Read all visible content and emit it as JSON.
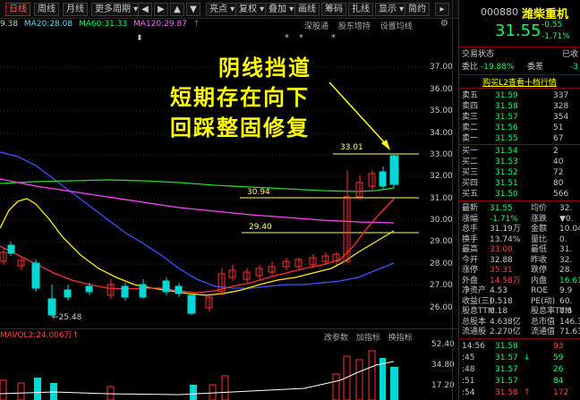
{
  "toolbar": {
    "left_partial": "9.38",
    "items": [
      "日线",
      "周线",
      "月线",
      "更多周期",
      "亮点",
      "复权",
      "叠加",
      "画线",
      "筹码",
      "扎线",
      "显示",
      "简约"
    ]
  },
  "ma_row": {
    "ma20": "MA20:28.08",
    "ma60": "MA60:31.33",
    "ma120": "MA120:29.87",
    "subtabs": [
      "深股通",
      "股东增持",
      "设置均线"
    ]
  },
  "price_axis": [
    "37.00",
    "36.00",
    "35.00",
    "34.00",
    "33.00",
    "32.00",
    "31.00",
    "30.00",
    "29.00",
    "28.00",
    "27.00",
    "26.00"
  ],
  "level_labels": {
    "high": "33.01",
    "mid": "30.94",
    "low": "29.40",
    "min": "25.48"
  },
  "annotation": [
    "阴线挡道",
    "短期存在向下",
    "回踩整固修复"
  ],
  "volume": {
    "header": "MAVOL2:24.006万",
    "tabs": [
      "改参数",
      "加指标",
      "换指标"
    ],
    "axis": [
      "52.40",
      "34.80",
      "17.20"
    ]
  },
  "quote": {
    "code": "000880",
    "name": "潍柴重机",
    "price": "31.55",
    "change": "-0.55",
    "change_pct": "-1.71%",
    "trade_status_label": "交易状态",
    "trade_status_value": "已收",
    "weibi_label": "委比",
    "weibi_value": "-19.88%",
    "weicha_label": "委差",
    "weicha_value": "-3",
    "buy_link": "购买L2查看十档行情",
    "asks": [
      {
        "label": "卖五",
        "price": "31.59",
        "vol": "337"
      },
      {
        "label": "卖四",
        "price": "31.58",
        "vol": "328"
      },
      {
        "label": "卖三",
        "price": "31.57",
        "vol": "354"
      },
      {
        "label": "卖二",
        "price": "31.56",
        "vol": "51"
      },
      {
        "label": "卖一",
        "price": "31.55",
        "vol": "67"
      }
    ],
    "bids": [
      {
        "label": "买一",
        "price": "31.54",
        "vol": "2"
      },
      {
        "label": "买二",
        "price": "31.53",
        "vol": "40"
      },
      {
        "label": "买三",
        "price": "31.52",
        "vol": "72"
      },
      {
        "label": "买四",
        "price": "31.51",
        "vol": "80"
      },
      {
        "label": "买五",
        "price": "31.50",
        "vol": "566"
      }
    ],
    "stats": [
      {
        "l1": "最新",
        "v1": "31.55",
        "l2": "均价",
        "v2": "32."
      },
      {
        "l1": "涨幅",
        "v1": "-1.71%",
        "l2": "涨跌",
        "v2": "▼0."
      },
      {
        "l1": "总手",
        "v1": "31.19万",
        "l2": "金额",
        "v2": "10.04"
      },
      {
        "l1": "换手",
        "v1": "13.74%",
        "l2": "量比",
        "v2": "0."
      },
      {
        "l1": "最高",
        "v1": "33.00",
        "l2": "最低",
        "v2": "31."
      },
      {
        "l1": "今开",
        "v1": "32.88",
        "l2": "昨收",
        "v2": "32."
      },
      {
        "l1": "涨停",
        "v1": "35.31",
        "l2": "跌停",
        "v2": "28."
      },
      {
        "l1": "外盘",
        "v1": "14.58万",
        "l2": "内盘",
        "v2": "16.61"
      },
      {
        "l1": "净资产",
        "v1": "4.53",
        "l2": "ROE",
        "v2": "9.9"
      },
      {
        "l1": "收益(三)",
        "v1": "0.518",
        "l2": "PE(动)",
        "v2": "60."
      },
      {
        "l1": "股息TTM",
        "v1": "0.18",
        "l2": "股息率TTM",
        "v2": "0.5"
      },
      {
        "l1": "总股本",
        "v1": "4.638亿",
        "l2": "总市值",
        "v2": "146.3"
      },
      {
        "l1": "流通股",
        "v1": "2.270亿",
        "l2": "流通值",
        "v2": "71.63"
      }
    ],
    "ticks": [
      {
        "time": "14:56",
        "price": "31.58",
        "vol": "93",
        "dir": ""
      },
      {
        "time": ":45",
        "price": "31.57",
        "vol": "59",
        "dir": "↓"
      },
      {
        "time": ":48",
        "price": "31.57",
        "vol": "26",
        "dir": ""
      },
      {
        "time": ":51",
        "price": "31.57",
        "vol": "84",
        "dir": ""
      },
      {
        "time": ":54",
        "price": "31.58",
        "vol": "172",
        "dir": "↑"
      }
    ]
  }
}
